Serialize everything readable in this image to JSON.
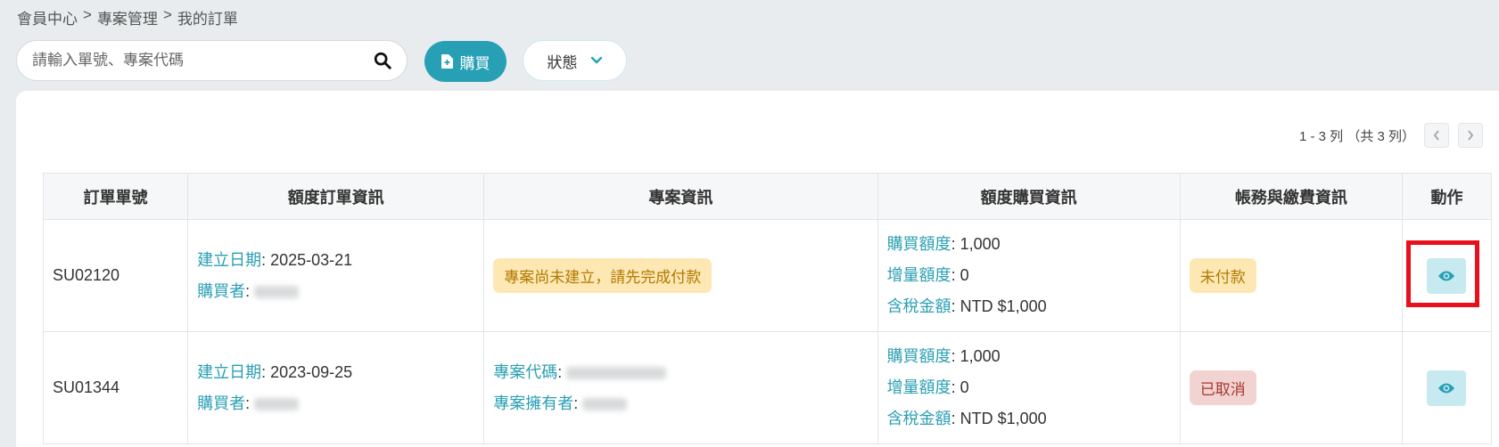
{
  "breadcrumb": {
    "items": [
      "會員中心",
      "專案管理",
      "我的訂單"
    ],
    "separator": ">"
  },
  "search": {
    "placeholder": "請輸入單號、專案代碼",
    "icon": "search-icon"
  },
  "toolbar": {
    "buy_label": "購買",
    "status_label": "狀態"
  },
  "pager": {
    "range_text": "1 - 3 列 （共 3 列）"
  },
  "table": {
    "headers": [
      "訂單單號",
      "額度訂單資訊",
      "專案資訊",
      "額度購買資訊",
      "帳務與繳費資訊",
      "動作"
    ],
    "rows": [
      {
        "order_no": "SU02120",
        "created_label": "建立日期",
        "created_date": "2025-03-21",
        "buyer_label": "購買者",
        "project_notice": "專案尚未建立，請先完成付款",
        "qty_label": "購買額度",
        "qty": "1,000",
        "inc_label": "增量額度",
        "inc": "0",
        "tax_label": "含稅金額",
        "tax": "NTD $1,000",
        "status": "未付款"
      },
      {
        "order_no": "SU01344",
        "created_label": "建立日期",
        "created_date": "2023-09-25",
        "buyer_label": "購買者",
        "project_code_label": "專案代碼",
        "project_owner_label": "專案擁有者",
        "qty_label": "購買額度",
        "qty": "1,000",
        "inc_label": "增量額度",
        "inc": "0",
        "tax_label": "含稅金額",
        "tax": "NTD $1,000",
        "status": "已取消"
      }
    ]
  },
  "colors": {
    "accent": "#27a0b5",
    "highlight": "#e8101b",
    "badge_unpaid": "#fde7b3",
    "badge_cancelled": "#f2d3d1"
  }
}
